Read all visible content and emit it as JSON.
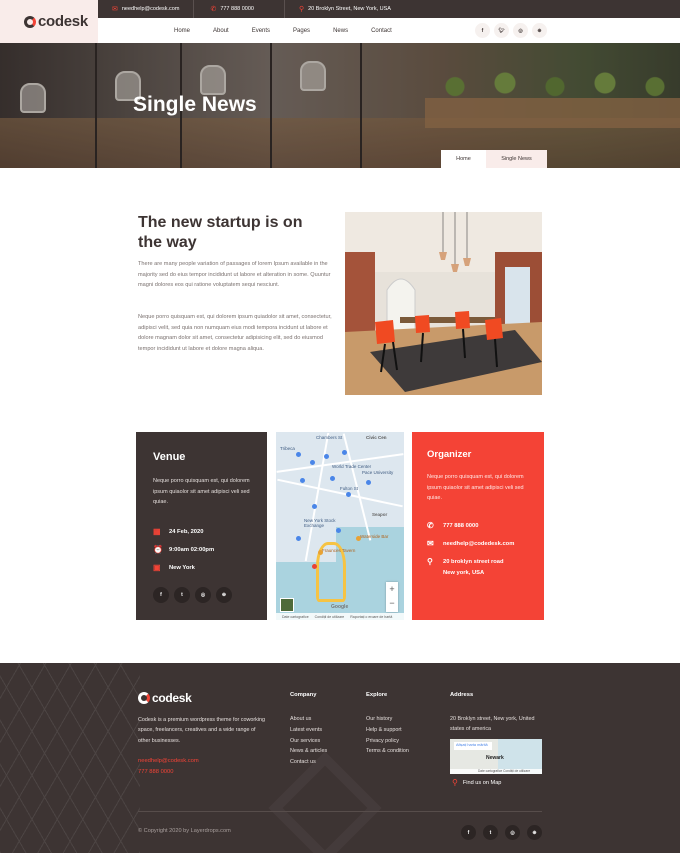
{
  "brand": {
    "name": "codesk"
  },
  "topbar": {
    "email": "needhelp@codesk.com",
    "phone": "777 888 0000",
    "address": "20 Broklyn Street, New York, USA"
  },
  "nav": [
    "Home",
    "About",
    "Events",
    "Pages",
    "News",
    "Contact"
  ],
  "social": [
    "facebook-icon",
    "twitter-icon",
    "instagram-icon",
    "dribbble-icon"
  ],
  "hero": {
    "title": "Single News",
    "breadcrumb_home": "Home",
    "breadcrumb_current": "Single News"
  },
  "article": {
    "title": "The new startup is on the way",
    "p1": "There are many people variation of passages of lorem Ipsum available in the majority sed do eius tempor incididunt ut labore et alteration in some. Quuntur magni dolores eos qui ratione voluptatem sequi nesciunt.",
    "p2": "Neque porro quisquam est, qui dolorem ipsum quiadolor sit amet, consectetur, adipisci velit, sed quia non numquam eius modi tempora incidunt ut labore et dolore magnam dolor sit amet, consectetur adipisicing elit, sed do eiusmod tempor incididunt ut labore et dolore magna aliqua."
  },
  "venue": {
    "title": "Venue",
    "desc": "Neque porro quisquam est, qui dolorem ipsum quiaolor sit amet adipisci veli sed quiae.",
    "date": "24 Feb, 2020",
    "time": "9:00am 02:00pm",
    "location": "New York"
  },
  "map": {
    "labels": [
      "Chambers St",
      "Civic Cen",
      "Tribeca",
      "World Trade Center",
      "Pace University",
      "Fulton St",
      "New York Stock Exchange",
      "Seapor",
      "Waterside Bar",
      "Fraunces Tavern"
    ],
    "footer": [
      "Date cartografice",
      "Condiții de utilizare",
      "Raportați o eroare de hartă"
    ],
    "google": "Google"
  },
  "organizer": {
    "title": "Organizer",
    "desc": "Neque porro quisquam est, qui dolorem ipsum quiaolor sit amet adipisci veli sed quiae.",
    "phone": "777 888 0000",
    "email": "needhelp@codedesk.com",
    "address_line1": "20 broklyn street road",
    "address_line2": "New york, USA"
  },
  "footer": {
    "desc": "Codesk is a premium wordpress theme for coworking space, freelancers, creatives and a wide range of other businesses.",
    "email": "needhelp@codesk.com",
    "phone": "777 888 0000",
    "company_title": "Company",
    "company_links": [
      "About us",
      "Latest events",
      "Our services",
      "News & articles",
      "Contact us"
    ],
    "explore_title": "Explore",
    "explore_links": [
      "Our history",
      "Help & support",
      "Privacy policy",
      "Terms & condition"
    ],
    "address_title": "Address",
    "address": "20 Broklyn street, New york, United states of america",
    "map_card": "Afișați harta mărită",
    "map_city": "Newark",
    "map_footer": "Date cartografice   Condiții de utilizare",
    "find_us": "Find us on Map",
    "copyright": "© Copyright 2020 by Layerdrops.com"
  },
  "colors": {
    "accent": "#f44336",
    "dark": "#3d3433",
    "pale": "#f9ecea"
  }
}
